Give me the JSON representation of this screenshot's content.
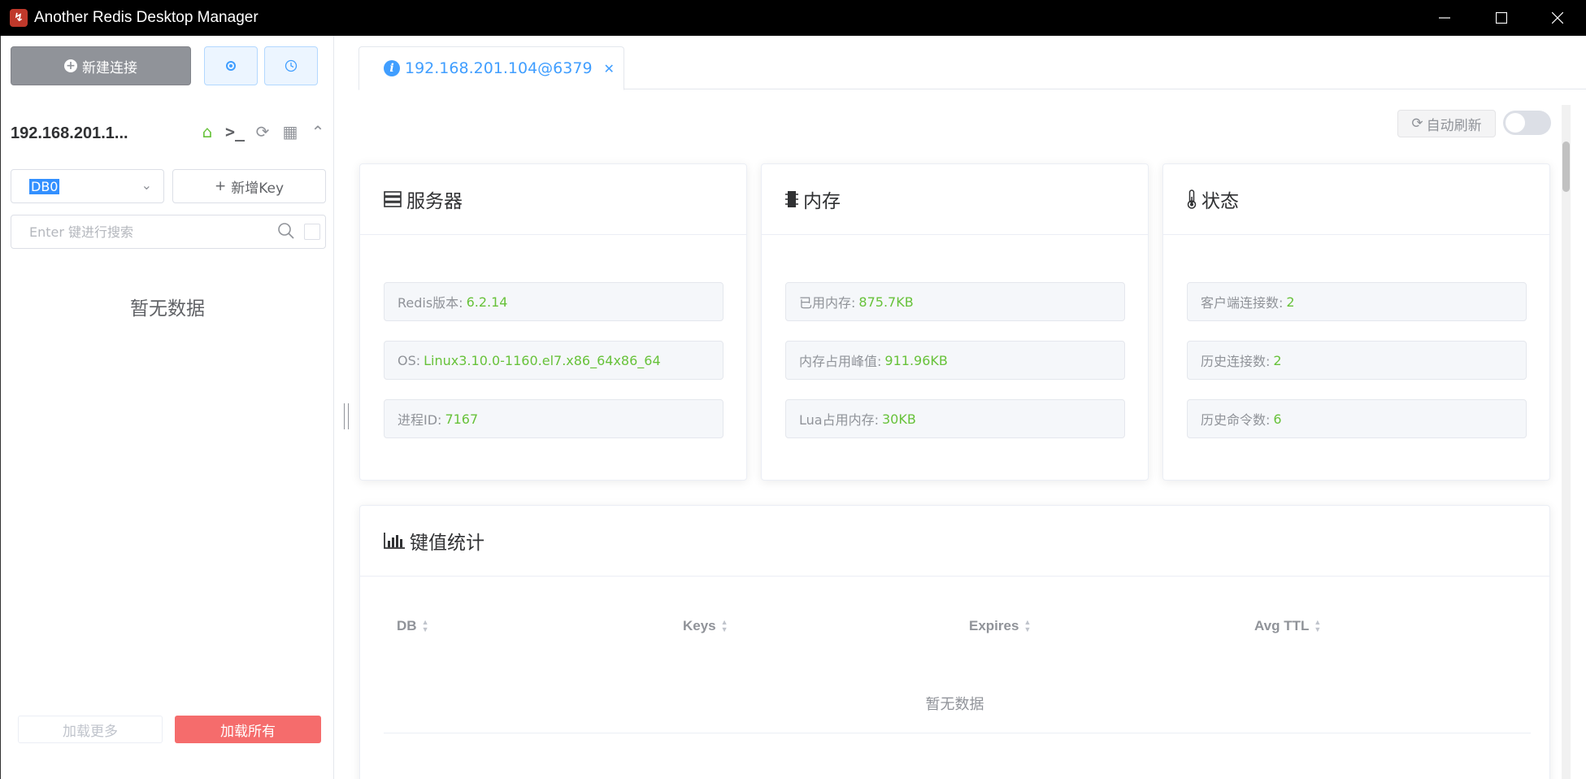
{
  "window": {
    "title": "Another Redis Desktop Manager",
    "minimize": "—",
    "maximize": "☐",
    "close": "✕"
  },
  "sidebar": {
    "new_connection_label": "新建连接",
    "connection_name": "192.168.201.1...",
    "db_select_value": "DB0",
    "add_key_label": "新增Key",
    "search_placeholder": "Enter 键进行搜索",
    "empty_text": "暂无数据",
    "load_more_label": "加载更多",
    "load_all_label": "加载所有"
  },
  "main": {
    "tab_label": "192.168.201.104@6379",
    "auto_refresh_label": "自动刷新",
    "auto_refresh_on": false,
    "cards": {
      "server": {
        "title": "服务器",
        "fields": [
          {
            "label": "Redis版本:",
            "value": "6.2.14"
          },
          {
            "label": "OS:",
            "value": "Linux3.10.0-1160.el7.x86_64x86_64"
          },
          {
            "label": "进程ID:",
            "value": "7167"
          }
        ]
      },
      "memory": {
        "title": "内存",
        "fields": [
          {
            "label": "已用内存:",
            "value": "875.7KB"
          },
          {
            "label": "内存占用峰值:",
            "value": "911.96KB"
          },
          {
            "label": "Lua占用内存:",
            "value": "30KB"
          }
        ]
      },
      "status": {
        "title": "状态",
        "fields": [
          {
            "label": "客户端连接数:",
            "value": "2"
          },
          {
            "label": "历史连接数:",
            "value": "2"
          },
          {
            "label": "历史命令数:",
            "value": "6"
          }
        ]
      }
    },
    "key_stats": {
      "title": "键值统计",
      "columns": [
        "DB",
        "Keys",
        "Expires",
        "Avg TTL"
      ],
      "empty_text": "暂无数据"
    }
  },
  "colors": {
    "accent": "#409eff",
    "success": "#67c23a",
    "danger": "#f56c6c",
    "muted": "#909399"
  }
}
